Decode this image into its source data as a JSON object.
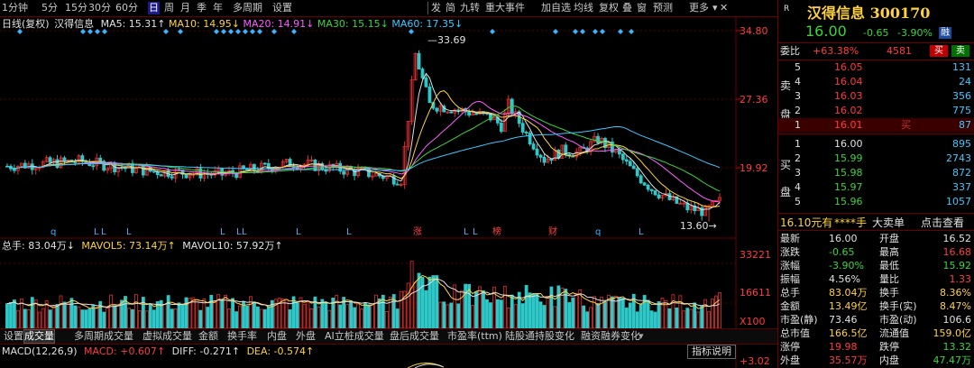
{
  "toolbar": {
    "left_items": [
      "1分钟",
      "5分",
      "15分",
      "30分",
      "60分",
      "日",
      "周",
      "月",
      "季",
      "年",
      "多周期",
      "设置"
    ],
    "active": "日",
    "right_items": [
      "发",
      "简",
      "九转",
      "重大事件",
      "加自选",
      "均线",
      "复权",
      "叠",
      "窗",
      "预测",
      "更多"
    ],
    "close": "✕"
  },
  "legend_price": {
    "title": "日线(复权)",
    "name": "汉得信息",
    "ma5": "MA5: 15.31↑",
    "ma10": "MA10: 14.95↓",
    "ma20": "MA20: 14.91↓",
    "ma30": "MA30: 15.15↓",
    "ma60": "MA60: 17.35↓"
  },
  "price_axis": [
    "34.80",
    "27.36",
    "19.92"
  ],
  "annotations": {
    "high": "33.69",
    "low": "13.60"
  },
  "event_marks": [
    "q",
    "L",
    "L",
    "L",
    "L",
    "L",
    "L",
    "L",
    "L",
    "L",
    "涨",
    "L",
    "榜",
    "财",
    "q",
    "L"
  ],
  "legend_volume": {
    "total": "总手: 83.04万↓",
    "mavol5": "MAVOL5: 73.14万↑",
    "mavol10": "MAVOL10: 57.92万↑"
  },
  "volume_axis": [
    "33221",
    "16611",
    "X100"
  ],
  "tabs": [
    "设置",
    "成交量",
    "多周期成交量",
    "虚拟成交量",
    "金额",
    "换手率",
    "内盘",
    "外盘",
    "AI立桩成交量",
    "盘后成交量",
    "市盈率(ttm)",
    "陆股通持股变化",
    "融资融券变化"
  ],
  "active_tab": "成交量",
  "macd_legend": {
    "label": "MACD(12,26,9)",
    "macd": "MACD: +0.607↑",
    "diff": "DIFF: -0.271↑",
    "dea": "DEA: -0.574↑"
  },
  "macd_button": "指标说明",
  "macd_axis_top": "+3.02",
  "quote": {
    "r_badge": "R",
    "name_code": "汉得信息 300170",
    "price": "16.00",
    "change": "-0.65",
    "change_pct": "-3.90%",
    "tag": "融",
    "weibi_label": "委比",
    "weibi_value": "+63.38%",
    "weibi_diff": "4581",
    "buy_btn": "买",
    "sell_btn": "卖",
    "sell_side_label": [
      "卖",
      "盘"
    ],
    "buy_side_label": [
      "买",
      "盘"
    ],
    "asks": [
      {
        "lvl": "5",
        "price": "16.05",
        "vol": "131"
      },
      {
        "lvl": "4",
        "price": "16.04",
        "vol": "24"
      },
      {
        "lvl": "3",
        "price": "16.03",
        "vol": "356"
      },
      {
        "lvl": "2",
        "price": "16.02",
        "vol": "775"
      },
      {
        "lvl": "1",
        "price": "16.01",
        "vol": "87"
      }
    ],
    "bids": [
      {
        "lvl": "1",
        "price": "16.00",
        "vol": "895"
      },
      {
        "lvl": "2",
        "price": "15.99",
        "vol": "2743"
      },
      {
        "lvl": "3",
        "price": "15.98",
        "vol": "872"
      },
      {
        "lvl": "4",
        "price": "15.97",
        "vol": "337"
      },
      {
        "lvl": "5",
        "price": "15.96",
        "vol": "1057"
      }
    ],
    "ask1_tag": "买",
    "bigorder": {
      "price": "16.10元有",
      "hand": "****手",
      "label": "大卖单",
      "link": "点击查看"
    },
    "stats": [
      [
        "最新",
        "16.00",
        "开盘",
        "16.52"
      ],
      [
        "涨跌",
        "-0.65",
        "最高",
        "16.68"
      ],
      [
        "涨幅",
        "-3.90%",
        "最低",
        "15.92"
      ],
      [
        "振幅",
        "4.56%",
        "量比",
        "1.33"
      ],
      [
        "总手",
        "83.04万",
        "换手",
        "8.36%"
      ],
      [
        "金额",
        "13.49亿",
        "换手(实)",
        "8.47%"
      ],
      [
        "市盈(静)",
        "73.46",
        "市盈(动)",
        "106.6"
      ],
      [
        "总市值",
        "166.5亿",
        "流通值",
        "159.0亿"
      ],
      [
        "涨停",
        "19.98",
        "跌停",
        "13.32"
      ],
      [
        "外盘",
        "35.57万",
        "内盘",
        "47.47万"
      ]
    ]
  },
  "chart_data": {
    "type": "candlestick",
    "y_ticks": [
      34.8,
      27.36,
      19.92
    ],
    "high": 33.69,
    "low": 13.6
  },
  "colors": {
    "up": "#ff3c3c",
    "down": "#3cd43c",
    "ma5": "#e0e0e0",
    "ma10": "#ffd23c",
    "ma20": "#ff5cff",
    "ma30": "#3cd43c",
    "ma60": "#3cc8ff"
  }
}
